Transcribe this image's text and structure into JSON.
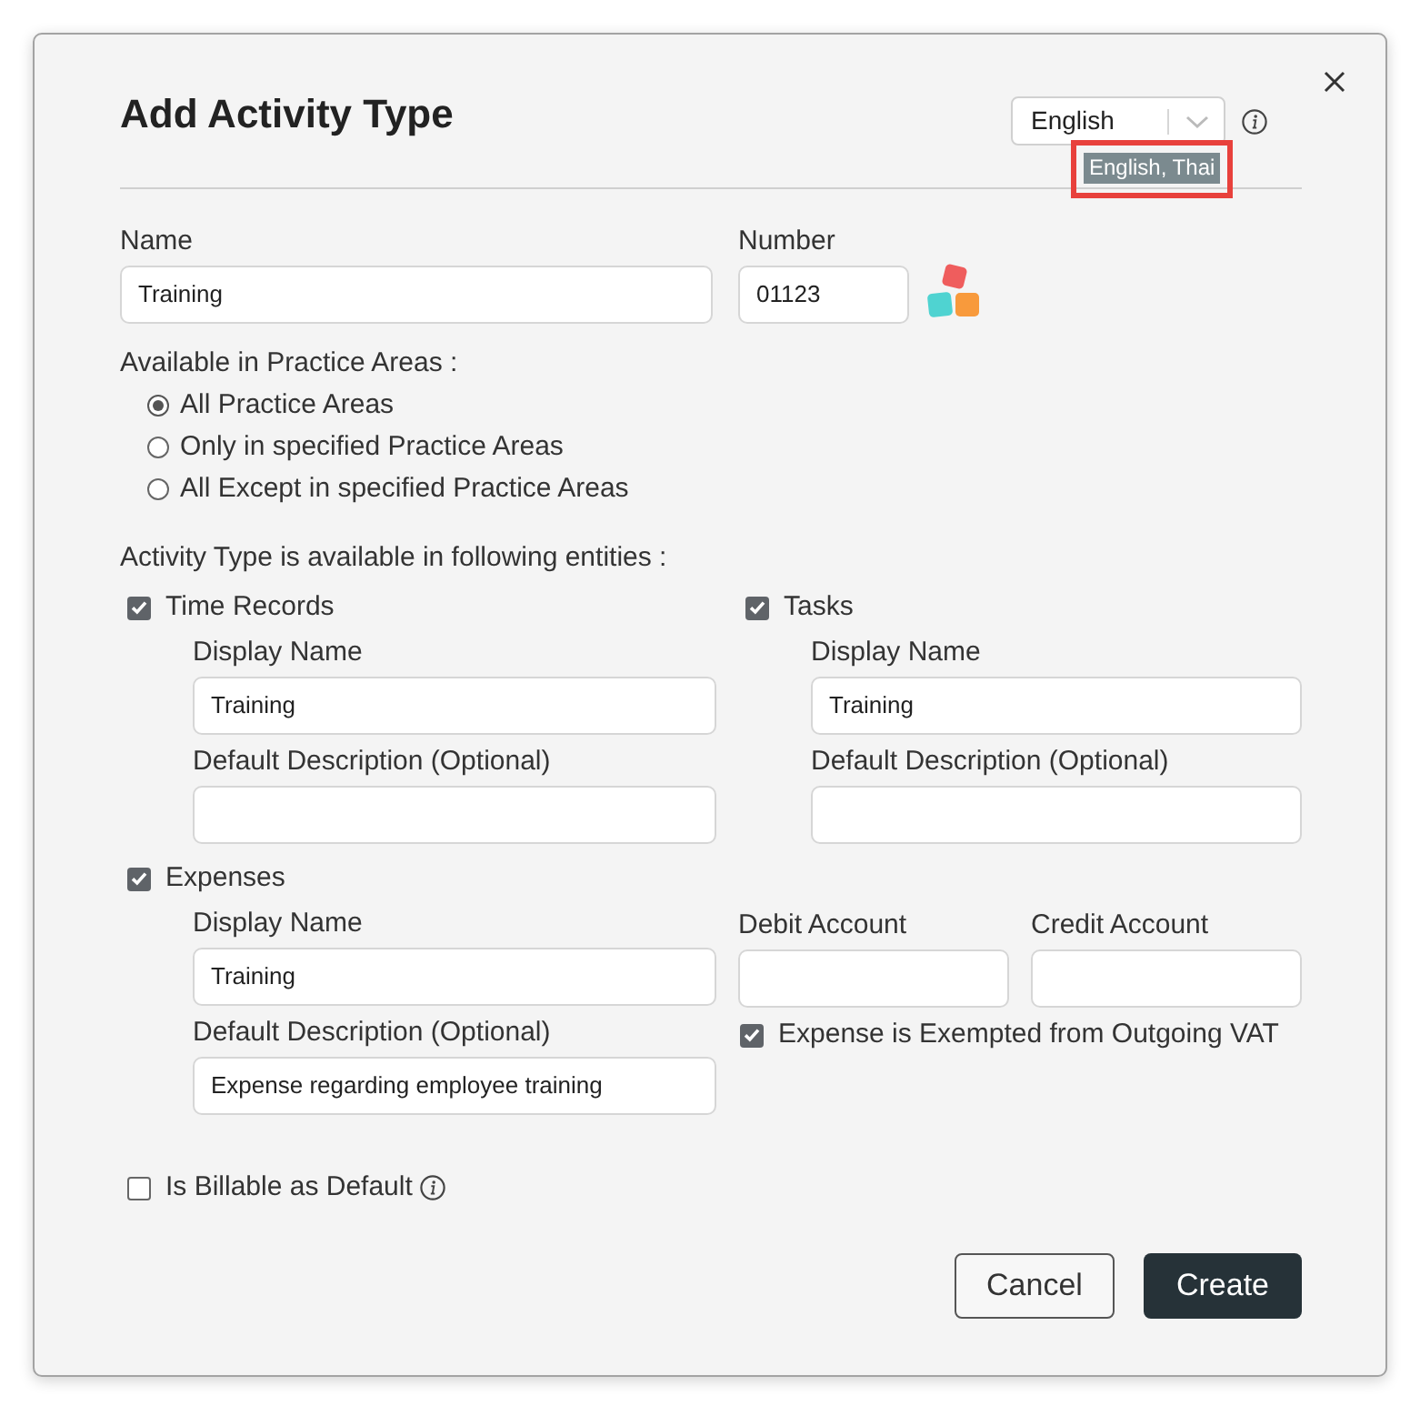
{
  "dialog": {
    "title": "Add Activity Type",
    "language_select": {
      "value": "English"
    },
    "language_tooltip": {
      "text": "English, Thai",
      "highlighted": true
    }
  },
  "name_field": {
    "label": "Name",
    "value": "Training"
  },
  "number_field": {
    "label": "Number",
    "value": "01123"
  },
  "practice_areas": {
    "label": "Available in Practice Areas :",
    "options": [
      {
        "label": "All Practice Areas",
        "selected": true
      },
      {
        "label": "Only in specified Practice Areas",
        "selected": false
      },
      {
        "label": "All Except in specified Practice Areas",
        "selected": false
      }
    ]
  },
  "entities": {
    "label": "Activity Type is available in following entities :",
    "time_records": {
      "label": "Time Records",
      "checked": true,
      "display_name": {
        "label": "Display Name",
        "value": "Training"
      },
      "default_description": {
        "label": "Default Description (Optional)"
      }
    },
    "tasks": {
      "label": "Tasks",
      "checked": true,
      "display_name": {
        "label": "Display Name",
        "value": "Training"
      },
      "default_description": {
        "label": "Default Description (Optional)"
      }
    },
    "expenses": {
      "label": "Expenses",
      "checked": true,
      "display_name": {
        "label": "Display Name",
        "value": "Training"
      },
      "default_description": {
        "label": "Default Description (Optional)",
        "value": "Expense regarding employee training"
      },
      "debit_account": {
        "label": "Debit Account"
      },
      "credit_account": {
        "label": "Credit Account"
      },
      "vat_exempt": {
        "label": "Expense is Exempted from Outgoing VAT",
        "checked": true
      }
    }
  },
  "billable": {
    "label": "Is Billable as Default",
    "checked": false
  },
  "buttons": [
    {
      "label": "Cancel",
      "kind": "secondary"
    },
    {
      "label": "Create",
      "kind": "primary"
    }
  ]
}
